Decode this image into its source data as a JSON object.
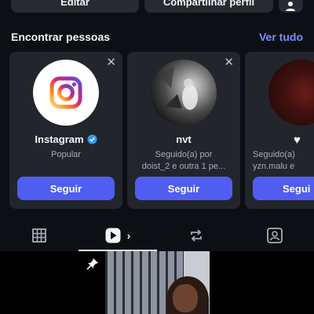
{
  "profile_actions": {
    "edit_label": "Editar",
    "share_label": "Compartilhar perfil",
    "discover_icon": "person-add-icon"
  },
  "suggestions": {
    "title": "Encontrar pessoas",
    "see_all": "Ver tudo",
    "cards": [
      {
        "name": "Instagram",
        "verified": true,
        "subtitle_lines": [
          "Popular"
        ],
        "follow_label": "Seguir",
        "close_label": "✕"
      },
      {
        "name": "nvt",
        "verified": false,
        "subtitle_lines": [
          "Seguido(a) por",
          "doist_2 e outra 1 pe..."
        ],
        "follow_label": "Seguir",
        "close_label": "✕"
      },
      {
        "name": "",
        "verified": false,
        "subtitle_lines": [
          "Seguido(a)",
          "yzn.malu e"
        ],
        "follow_label": "Segui",
        "close_label": ""
      }
    ]
  },
  "tabs": [
    {
      "icon": "grid-icon"
    },
    {
      "icon": "reels-play-icon",
      "active": true
    },
    {
      "icon": "repost-icon"
    },
    {
      "icon": "tagged-person-icon"
    }
  ],
  "colors": {
    "background": "#0c1014",
    "card": "#22262c",
    "accent": "#4f5ef0",
    "link": "#7c8cff",
    "verified": "#3897f0"
  }
}
